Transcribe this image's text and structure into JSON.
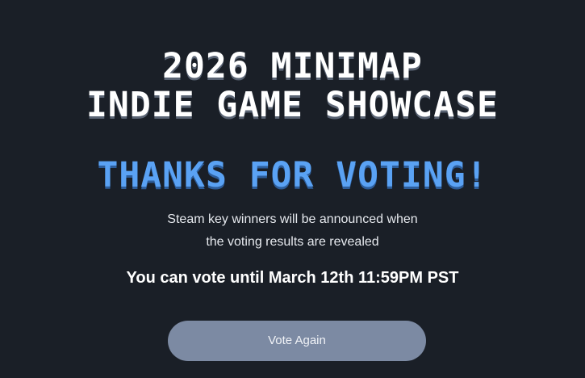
{
  "header": {
    "title_line1": "2026 MINIMAP",
    "title_line2": "INDIE GAME SHOWCASE"
  },
  "main": {
    "thanks": "THANKS FOR VOTING!",
    "subtitle_line1": "Steam key winners will be announced when",
    "subtitle_line2": "the voting results are revealed",
    "deadline": "You can vote until March 12th 11:59PM PST",
    "vote_again_label": "Vote Again"
  },
  "colors": {
    "background": "#1a1f27",
    "accent": "#5aa2f4",
    "button": "#7c8aa3"
  }
}
